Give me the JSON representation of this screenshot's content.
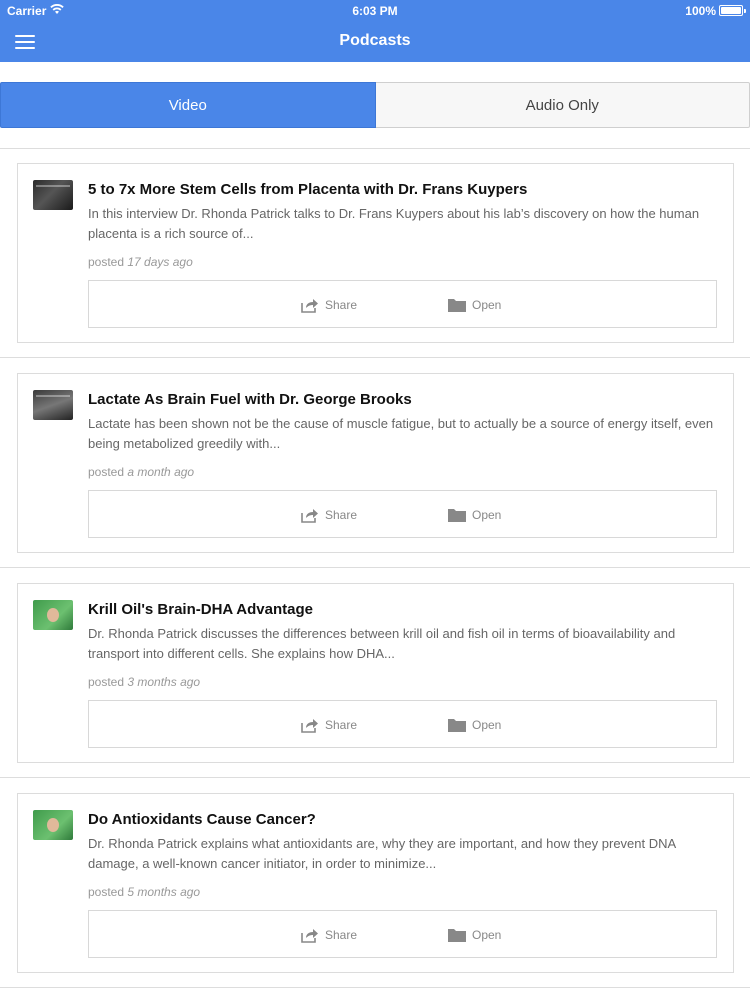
{
  "status_bar": {
    "carrier": "Carrier",
    "time": "6:03 PM",
    "battery": "100%"
  },
  "header": {
    "title": "Podcasts",
    "menu_icon": "hamburger-menu-icon"
  },
  "tabs": [
    {
      "label": "Video",
      "active": true
    },
    {
      "label": "Audio Only",
      "active": false
    }
  ],
  "colors": {
    "accent": "#4a86e8"
  },
  "podcasts": [
    {
      "title": "5 to 7x More Stem Cells from Placenta with Dr. Frans Kuypers",
      "description": "In this interview Dr. Rhonda Patrick talks to Dr. Frans Kuypers about his lab’s discovery on how the human placenta is a rich source of...",
      "posted_prefix": "posted",
      "posted_ago": "17 days ago",
      "share_label": "Share",
      "open_label": "Open"
    },
    {
      "title": "Lactate As Brain Fuel with Dr. George Brooks",
      "description": "Lactate has been shown not be the cause of muscle fatigue, but to actually be a source of energy itself, even being metabolized greedily with...",
      "posted_prefix": "posted",
      "posted_ago": "a month ago",
      "share_label": "Share",
      "open_label": "Open"
    },
    {
      "title": "Krill Oil's Brain-DHA Advantage",
      "description": "Dr. Rhonda Patrick discusses the differences between krill oil and fish oil in terms of bioavailability and transport into different cells. She explains how DHA...",
      "posted_prefix": "posted",
      "posted_ago": "3 months ago",
      "share_label": "Share",
      "open_label": "Open"
    },
    {
      "title": "Do Antioxidants Cause Cancer?",
      "description": "Dr. Rhonda Patrick explains what antioxidants are, why they are important, and how they prevent DNA damage, a well-known cancer initiator, in order to minimize...",
      "posted_prefix": "posted",
      "posted_ago": "5 months ago",
      "share_label": "Share",
      "open_label": "Open"
    }
  ]
}
